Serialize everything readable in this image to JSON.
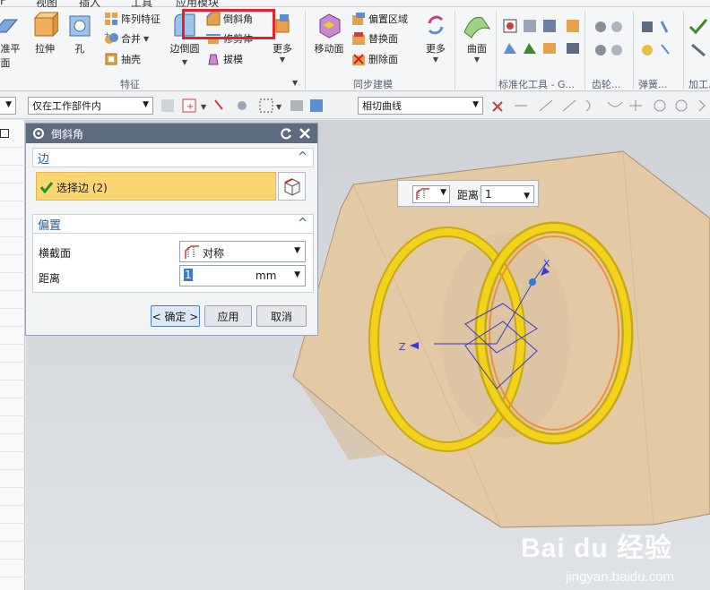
{
  "menubar": {
    "fragments": [
      "F",
      "视图",
      "插入",
      "工具",
      "应用模块"
    ]
  },
  "ribbon": {
    "groups": {
      "feature": "特征",
      "sync": "同步建模",
      "standard": "标准化工具 - G...",
      "gear": "齿轮...",
      "spring": "弹簧...",
      "machining": "加工..."
    },
    "buttons": {
      "datum": "基准平面",
      "extrude": "拉伸",
      "hole": "孔",
      "pattern": "阵列特征",
      "unite": "合并",
      "shell": "抽壳",
      "edge_blend": "边倒圆",
      "chamfer": "倒斜角",
      "trim_body": "修剪体",
      "draft": "拔模",
      "more1": "更多",
      "move_face": "移动面",
      "offset_region": "偏置区域",
      "replace_face": "替换面",
      "delete_face": "删除面",
      "more2": "更多",
      "surface": "曲面"
    }
  },
  "toolbar": {
    "filter_value": "仅在工作部件内",
    "curve_rule": "相切曲线"
  },
  "dialog": {
    "title": "倒斜角",
    "edge_section": "边",
    "select_edge": "选择边 (2)",
    "offset_section": "偏置",
    "cross_section_label": "横截面",
    "cross_section_value": "对称",
    "distance_label": "距离",
    "distance_value": "1",
    "unit": "mm",
    "ok": "< 确定 >",
    "apply": "应用",
    "cancel": "取消"
  },
  "viewport": {
    "popup_label": "距离",
    "popup_value": "1",
    "axis_x": "X",
    "axis_z": "Z"
  },
  "watermark": {
    "brand": "Bai du 经验",
    "url": "jingyan.baidu.com"
  },
  "colors": {
    "highlight_box": "#e5222a",
    "body": "#e3c9a4",
    "ring": "#f2d21b",
    "selection": "#fad673"
  }
}
